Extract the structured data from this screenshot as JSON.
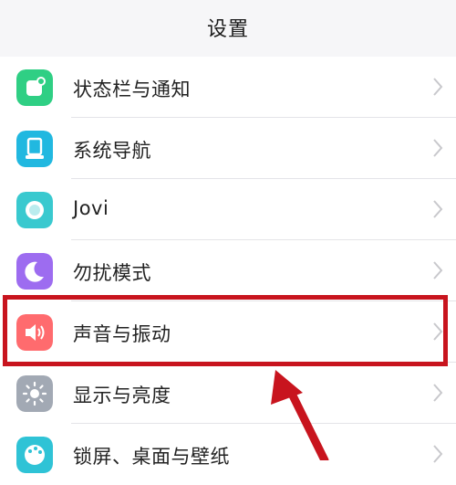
{
  "header": {
    "title": "设置"
  },
  "items": [
    {
      "label": "状态栏与通知",
      "icon": "notification-icon",
      "color": "#2fcf84"
    },
    {
      "label": "系统导航",
      "icon": "navigation-icon",
      "color": "#21b8e0"
    },
    {
      "label": "Jovi",
      "icon": "jovi-icon",
      "color": "#39c9cf"
    },
    {
      "label": "勿扰模式",
      "icon": "moon-icon",
      "color": "#9d6cf0"
    },
    {
      "label": "声音与振动",
      "icon": "speaker-icon",
      "color": "#ff6b6e"
    },
    {
      "label": "显示与亮度",
      "icon": "sun-icon",
      "color": "#a2a9b4"
    },
    {
      "label": "锁屏、桌面与壁纸",
      "icon": "palette-icon",
      "color": "#2fc3d6"
    }
  ],
  "annotation": {
    "highlight_color": "#c8141e",
    "arrow_color": "#c8141e"
  }
}
